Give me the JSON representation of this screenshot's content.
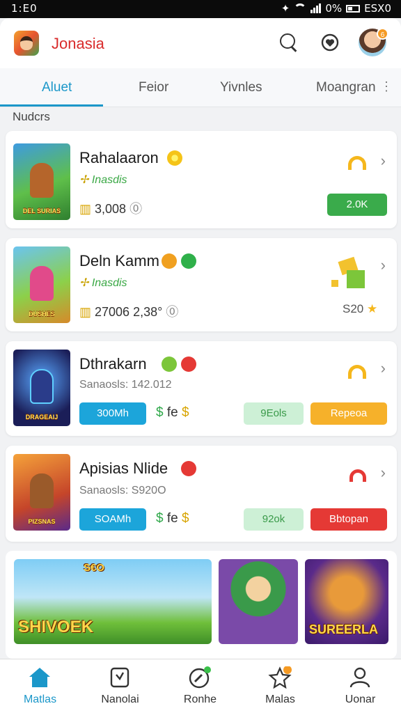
{
  "status_bar": {
    "time": "1:E0",
    "battery": "0%",
    "right_text": "ESX0"
  },
  "header": {
    "title": "Jonasia",
    "icons": [
      "app-logo",
      "search-icon",
      "heart-icon",
      "avatar"
    ],
    "avatar_badge": "6"
  },
  "tabs": [
    {
      "label": "Aluet",
      "active": true
    },
    {
      "label": "Feior",
      "active": false
    },
    {
      "label": "Yivnles",
      "active": false
    },
    {
      "label": "Moangran",
      "active": false
    }
  ],
  "section_label": "Nudcrs",
  "cards": [
    {
      "title": "Rahalaaron",
      "subtitle": "Inasdis",
      "meta": "3,008",
      "action": "2.0K",
      "thumb_text": "DEL SURIAS"
    },
    {
      "title": "Deln Kamm",
      "subtitle": "Inasdis",
      "meta": "27006 2,38°",
      "price": "S20",
      "thumb_text": "DUSHES"
    },
    {
      "title": "Dthrakarn",
      "subtitle": "Sanaosls: 142.012",
      "btn_primary": "300Mh",
      "btn_secondary": "9Eols",
      "btn_action": "Repeoa",
      "thumb_text": "DRAGEAIJ"
    },
    {
      "title": "Apisias Nlide",
      "subtitle": "Sanaosls: S920O",
      "btn_primary": "SOAMh",
      "btn_secondary": "92ok",
      "btn_action": "Bbtopan",
      "thumb_text": "PIZSNAS"
    }
  ],
  "banner": {
    "tiles": [
      {
        "text": "SHIVOEK"
      },
      {
        "text": ""
      },
      {
        "text": "SUREERLA"
      }
    ],
    "badge": "S€O"
  },
  "nav": [
    {
      "label": "Matlas",
      "active": true
    },
    {
      "label": "Nanolai",
      "active": false
    },
    {
      "label": "Ronhe",
      "active": false
    },
    {
      "label": "Malas",
      "active": false
    },
    {
      "label": "Uonar",
      "active": false
    }
  ],
  "colors": {
    "accent": "#1b97c9",
    "green": "#3aab4b",
    "orange": "#f6b12a",
    "red": "#e53935",
    "title_red": "#d92b2b"
  }
}
